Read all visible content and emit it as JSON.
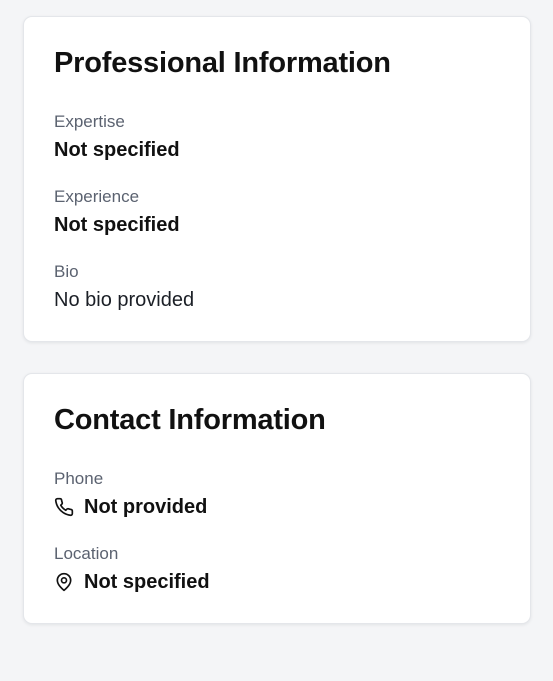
{
  "professional": {
    "title": "Professional Information",
    "expertise": {
      "label": "Expertise",
      "value": "Not specified"
    },
    "experience": {
      "label": "Experience",
      "value": "Not specified"
    },
    "bio": {
      "label": "Bio",
      "value": "No bio provided"
    }
  },
  "contact": {
    "title": "Contact Information",
    "phone": {
      "label": "Phone",
      "value": "Not provided",
      "icon": "phone-icon"
    },
    "location": {
      "label": "Location",
      "value": "Not specified",
      "icon": "map-pin-icon"
    }
  },
  "colors": {
    "background": "#f4f5f7",
    "card": "#ffffff",
    "label": "#5b6270",
    "text": "#111111"
  }
}
